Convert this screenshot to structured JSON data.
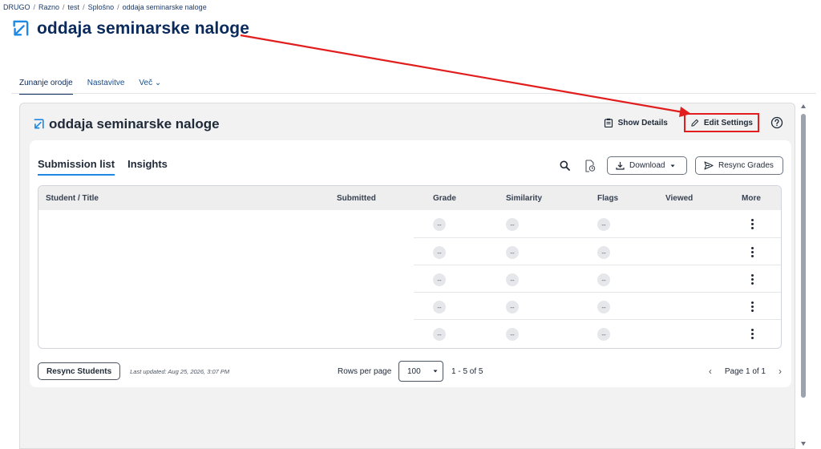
{
  "breadcrumb": [
    "DRUGO",
    "Razno",
    "test",
    "Splošno",
    "oddaja seminarske naloge"
  ],
  "breadcrumb_sep": "/",
  "page_title": "oddaja seminarske naloge",
  "top_tabs": [
    {
      "label": "Zunanje orodje",
      "active": true
    },
    {
      "label": "Nastavitve",
      "active": false
    },
    {
      "label": "Več ⌄",
      "active": false
    }
  ],
  "panel": {
    "title": "oddaja seminarske naloge",
    "show_details": "Show Details",
    "edit_settings": "Edit Settings"
  },
  "card": {
    "tabs": [
      {
        "label": "Submission list",
        "active": true
      },
      {
        "label": "Insights",
        "active": false
      }
    ],
    "download": "Download",
    "resync_grades": "Resync Grades",
    "columns": [
      "Student / Title",
      "Submitted",
      "Grade",
      "Similarity",
      "Flags",
      "Viewed",
      "More"
    ],
    "placeholder": "--",
    "row_count": 5
  },
  "footer": {
    "resync_students": "Resync Students",
    "last_updated": "Last updated: Aug 25, 2026, 3:07 PM",
    "rows_per_page_label": "Rows per page",
    "rows_per_page_value": "100",
    "range": "1 - 5 of 5",
    "page": "Page 1 of 1"
  },
  "colors": {
    "annotation": "#e11d1d",
    "accent": "#1e88e5",
    "title": "#0b2a5c"
  }
}
